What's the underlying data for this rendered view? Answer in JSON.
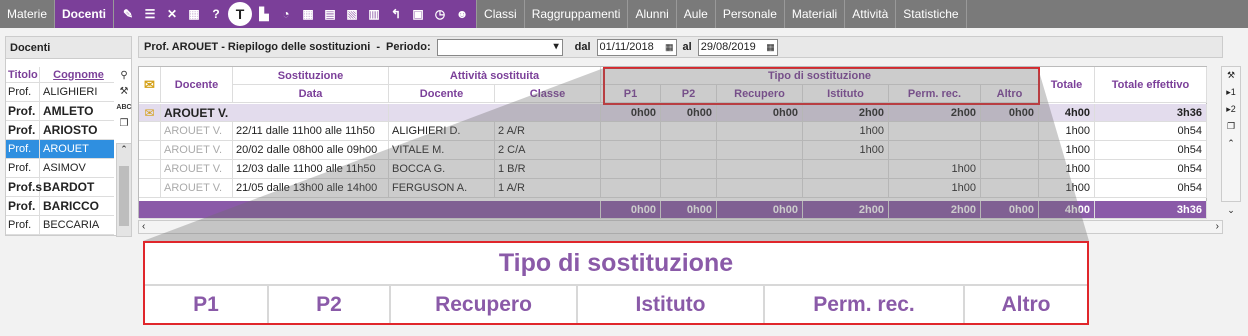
{
  "menu": {
    "items_left": [
      "Materie"
    ],
    "active": "Docenti",
    "items_right": [
      "Classi",
      "Raggruppamenti",
      "Alunni",
      "Aule",
      "Personale",
      "Materiali",
      "Attività",
      "Statistiche"
    ],
    "tools": [
      "edit-list-icon",
      "list-icon",
      "tools-icon",
      "grid-question-icon",
      "question-icon",
      "t-circle-icon",
      "building-icon",
      "building-clock-icon",
      "grid-icon",
      "grid-x-icon",
      "grid-x2-icon",
      "table-icon",
      "t-arrow-icon",
      "one-box-icon",
      "chat-clock-icon",
      "person-question-icon"
    ],
    "active_tool_label": "T"
  },
  "left": {
    "title": "Docenti",
    "col_titolo": "Titolo",
    "col_cognome": "Cognome",
    "rows": [
      {
        "titolo": "Prof.",
        "cognome": "ALIGHIERI",
        "bold": false,
        "selected": false
      },
      {
        "titolo": "Prof.",
        "cognome": "AMLETO",
        "bold": true,
        "selected": false
      },
      {
        "titolo": "Prof.",
        "cognome": "ARIOSTO",
        "bold": true,
        "selected": false
      },
      {
        "titolo": "Prof.",
        "cognome": "AROUET",
        "bold": false,
        "selected": true
      },
      {
        "titolo": "Prof.",
        "cognome": "ASIMOV",
        "bold": false,
        "selected": false
      },
      {
        "titolo": "Prof.s",
        "cognome": "BARDOT",
        "bold": true,
        "selected": false
      },
      {
        "titolo": "Prof.",
        "cognome": "BARICCO",
        "bold": true,
        "selected": false
      },
      {
        "titolo": "Prof.",
        "cognome": "BECCARIA",
        "bold": false,
        "selected": false
      }
    ],
    "abc": "ABC"
  },
  "header": {
    "title": "Prof. AROUET - Riepilogo delle sostituzioni",
    "sep": "-",
    "periodo_label": "Periodo:",
    "dal_label": "dal",
    "dal_value": "01/11/2018",
    "al_label": "al",
    "al_value": "29/08/2019"
  },
  "table": {
    "h_docente": "Docente",
    "h_sostituzione": "Sostituzione",
    "h_data": "Data",
    "h_attivita": "Attività sostituita",
    "h_docente2": "Docente",
    "h_classe": "Classe",
    "h_tipo": "Tipo di sostituzione",
    "h_p1": "P1",
    "h_p2": "P2",
    "h_recupero": "Recupero",
    "h_istituto": "Istituto",
    "h_perm": "Perm. rec.",
    "h_altro": "Altro",
    "h_totale": "Totale",
    "h_totale_eff": "Totale effettivo",
    "group": {
      "docente": "AROUET V.",
      "p1": "0h00",
      "p2": "0h00",
      "recupero": "0h00",
      "istituto": "2h00",
      "perm": "2h00",
      "altro": "0h00",
      "totale": "4h00",
      "totale_eff": "3h36"
    },
    "rows": [
      {
        "docente": "AROUET V.",
        "data": "22/11 dalle 11h00 alle 11h50",
        "docente2": "ALIGHIERI D.",
        "classe": "2 A/R",
        "istituto": "1h00",
        "perm": "",
        "totale": "1h00",
        "totale_eff": "0h54"
      },
      {
        "docente": "AROUET V.",
        "data": "20/02 dalle 08h00 alle 09h00",
        "docente2": "VITALE M.",
        "classe": "2 C/A",
        "istituto": "1h00",
        "perm": "",
        "totale": "1h00",
        "totale_eff": "0h54"
      },
      {
        "docente": "AROUET V.",
        "data": "12/03 dalle 11h00 alle 11h50",
        "docente2": "BOCCA G.",
        "classe": "1 B/R",
        "istituto": "",
        "perm": "1h00",
        "totale": "1h00",
        "totale_eff": "0h54"
      },
      {
        "docente": "AROUET V.",
        "data": "21/05 dalle 13h00 alle 14h00",
        "docente2": "FERGUSON A.",
        "classe": "1 A/R",
        "istituto": "",
        "perm": "1h00",
        "totale": "1h00",
        "totale_eff": "0h54"
      }
    ],
    "total": {
      "p1": "0h00",
      "p2": "0h00",
      "recupero": "0h00",
      "istituto": "2h00",
      "perm": "2h00",
      "altro": "0h00",
      "totale": "4h00",
      "totale_eff": "3h36"
    }
  },
  "right_panel": {
    "b1": "▸1",
    "b2": "▸2"
  },
  "zoom": {
    "title": "Tipo di sostituzione",
    "cols": [
      "P1",
      "P2",
      "Recupero",
      "Istituto",
      "Perm. rec.",
      "Altro"
    ]
  },
  "colors": {
    "accent": "#7b3f99",
    "highlight": "#e0262b",
    "selected": "#2f8fe0"
  }
}
